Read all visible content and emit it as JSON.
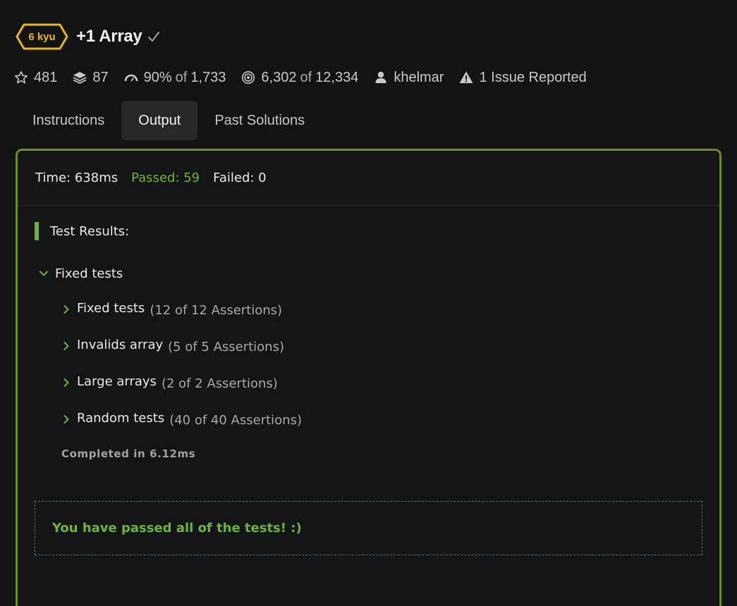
{
  "kata": {
    "rank": "6 kyu",
    "title": "+1 Array",
    "rank_color": "#ecb613"
  },
  "stats": {
    "stars": "481",
    "collections": "87",
    "satisfaction": "90%",
    "satisfaction_of": "of",
    "satisfaction_votes": "1,733",
    "completed": "6,302",
    "completed_of": "of",
    "attempts": "12,334",
    "author": "khelmar",
    "issues": "1 Issue Reported"
  },
  "tabs": [
    {
      "label": "Instructions",
      "active": false
    },
    {
      "label": "Output",
      "active": true
    },
    {
      "label": "Past Solutions",
      "active": false
    }
  ],
  "output": {
    "time": "Time: 638ms",
    "passed": "Passed: 59",
    "failed": "Failed: 0",
    "results_title": "Test Results:",
    "group": "Fixed tests",
    "tests": [
      {
        "name": "Fixed tests",
        "count": "(12 of 12 Assertions)"
      },
      {
        "name": "Invalids array",
        "count": "(5 of 5 Assertions)"
      },
      {
        "name": "Large arrays",
        "count": "(2 of 2 Assertions)"
      },
      {
        "name": "Random tests",
        "count": "(40 of 40 Assertions)"
      }
    ],
    "completed": "Completed in 6.12ms",
    "success_message": "You have passed all of the tests! :)",
    "accent_color": "#6fb33d",
    "border_color": "#6b8d24"
  },
  "icons": [
    "star-icon",
    "layers-icon",
    "gauge-icon",
    "target-icon",
    "user-icon",
    "warning-icon",
    "check-icon",
    "chevron-down-icon",
    "chevron-right-icon"
  ]
}
